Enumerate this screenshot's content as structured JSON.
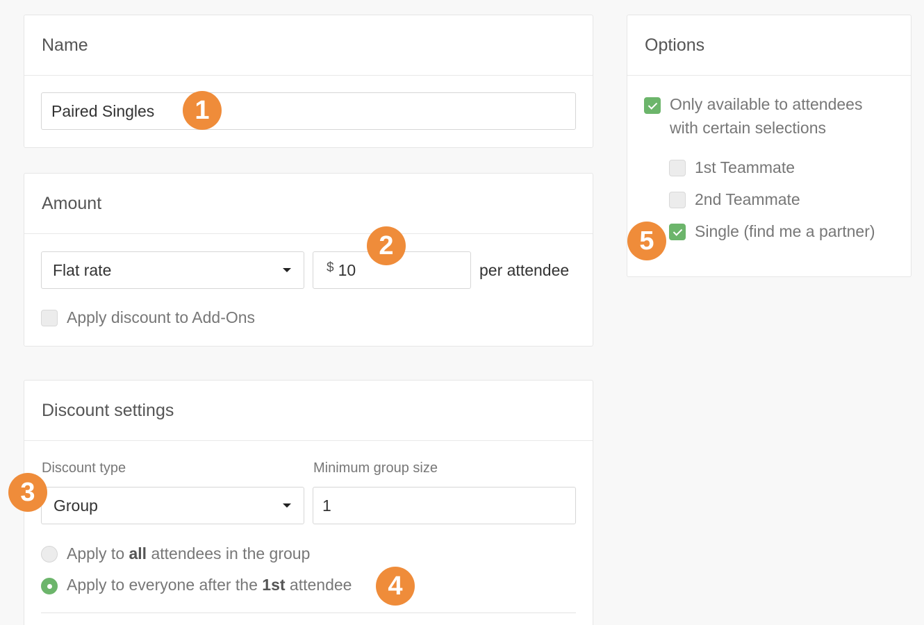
{
  "name_panel": {
    "title": "Name",
    "name_value": "Paired Singles"
  },
  "amount_panel": {
    "title": "Amount",
    "rate_type": "Flat rate",
    "currency_symbol": "$",
    "amount_value": "10",
    "per_label": "per attendee",
    "apply_addons_label": "Apply discount to Add-Ons",
    "apply_addons_checked": false
  },
  "discount_panel": {
    "title": "Discount settings",
    "discount_type_label": "Discount type",
    "discount_type_value": "Group",
    "min_group_label": "Minimum group size",
    "min_group_value": "1",
    "radio_all": {
      "prefix": "Apply to ",
      "bold": "all",
      "suffix": " attendees in the group",
      "checked": false
    },
    "radio_after": {
      "prefix": "Apply to everyone after the ",
      "bold": "1st",
      "suffix": " attendee",
      "checked": true
    }
  },
  "options_panel": {
    "title": "Options",
    "restrict_line1": "Only available to attendees",
    "restrict_line2": "with certain selections",
    "restrict_checked": true,
    "selections": [
      {
        "label": "1st Teammate",
        "checked": false
      },
      {
        "label": "2nd Teammate",
        "checked": false
      },
      {
        "label": "Single (find me a partner)",
        "checked": true
      }
    ]
  },
  "badges": [
    "1",
    "2",
    "3",
    "4",
    "5"
  ],
  "colors": {
    "accent_green": "#6cb56b",
    "badge_orange": "#ef8c3a"
  }
}
